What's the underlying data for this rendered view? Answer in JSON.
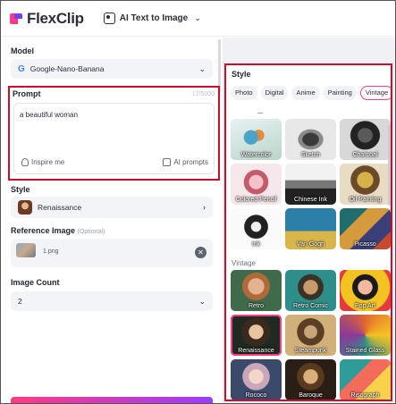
{
  "header": {
    "logo_text": "FlexClip",
    "tool_label": "AI Text to Image"
  },
  "left": {
    "model": {
      "label": "Model",
      "value": "Google-Nano-Banana"
    },
    "prompt": {
      "label": "Prompt",
      "counter": "17/5000",
      "value": "a beautiful woman",
      "inspire_label": "Inspire me",
      "ai_prompts_label": "AI prompts"
    },
    "style": {
      "label": "Style",
      "value": "Renaissance"
    },
    "reference": {
      "label": "Reference Image",
      "optional": "(Optional)",
      "file_name": "1.png"
    },
    "image_count": {
      "label": "Image Count",
      "value": "2"
    }
  },
  "style_panel": {
    "title": "Style",
    "tabs": [
      {
        "label": "Photo",
        "active": false
      },
      {
        "label": "Digital",
        "active": false
      },
      {
        "label": "Anime",
        "active": false
      },
      {
        "label": "Painting",
        "active": false
      },
      {
        "label": "Vintage",
        "active": true
      }
    ],
    "painting_cards": [
      {
        "label": "Watercolor",
        "art": "a-water"
      },
      {
        "label": "Sketch",
        "art": "a-sketch"
      },
      {
        "label": "Charcoal",
        "art": "a-charcoal"
      },
      {
        "label": "Colored Pencil",
        "art": "a-pencil"
      },
      {
        "label": "Chinese Ink",
        "art": "a-ink"
      },
      {
        "label": "Oil Painting",
        "art": "a-oil"
      },
      {
        "label": "Ink",
        "art": "a-inkheart"
      },
      {
        "label": "Van Gogh",
        "art": "a-vangogh"
      },
      {
        "label": "Picasso",
        "art": "a-picasso"
      }
    ],
    "vintage_section_label": "Vintage",
    "vintage_cards": [
      {
        "label": "Retro",
        "art": "a-retro",
        "selected": false
      },
      {
        "label": "Retro Comic",
        "art": "a-comic",
        "selected": false
      },
      {
        "label": "Pop Art",
        "art": "a-popart",
        "selected": false
      },
      {
        "label": "Renaissance",
        "art": "a-ren",
        "selected": true
      },
      {
        "label": "Steampunk",
        "art": "a-steam",
        "selected": false
      },
      {
        "label": "Stained Glass",
        "art": "a-stained",
        "selected": false
      },
      {
        "label": "Rococo",
        "art": "a-rococo",
        "selected": false
      },
      {
        "label": "Baroque",
        "art": "a-baroque",
        "selected": false
      },
      {
        "label": "Risograph",
        "art": "a-riso",
        "selected": false
      }
    ]
  },
  "colors": {
    "brand_pink": "#ff3b7f",
    "highlight_red": "#c8102e"
  }
}
